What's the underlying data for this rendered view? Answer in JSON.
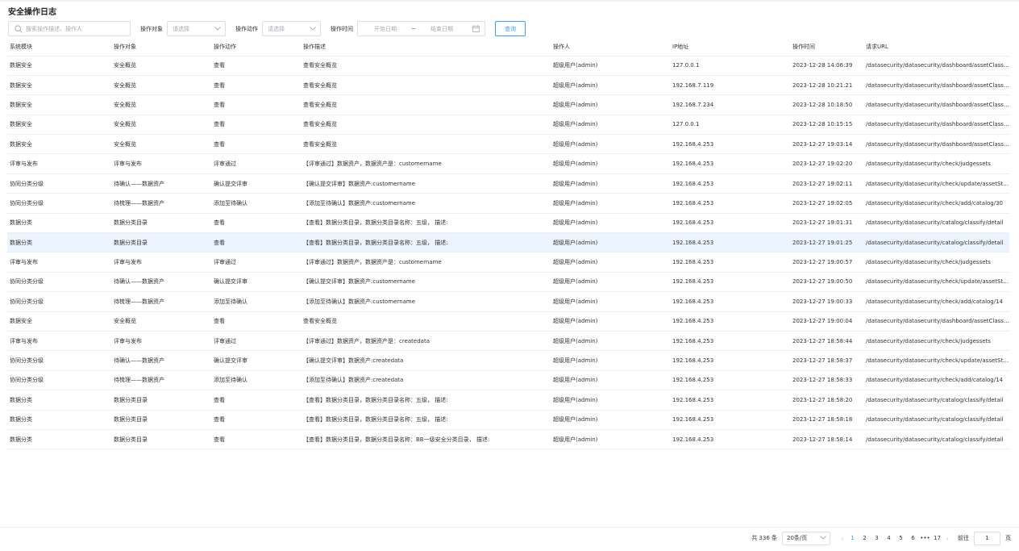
{
  "page": {
    "title": "安全操作日志"
  },
  "filters": {
    "search_placeholder": "搜索操作描述、操作人",
    "object_label": "操作对象",
    "object_placeholder": "请选择",
    "action_label": "操作动作",
    "action_placeholder": "请选择",
    "time_label": "操作时间",
    "start_placeholder": "开始日期",
    "range_sep": "~",
    "end_placeholder": "结束日期",
    "query_label": "查询"
  },
  "columns": [
    "系统模块",
    "操作对象",
    "操作动作",
    "操作描述",
    "操作人",
    "IP地址",
    "操作时间",
    "请求URL"
  ],
  "rows": [
    [
      "数据安全",
      "安全概览",
      "查看",
      "查看安全概览",
      "超级用户(admin)",
      "127.0.0.1",
      "2023-12-28 14:06:39",
      "/datasecurity/datasecurity/dashboard/assetClassify"
    ],
    [
      "数据安全",
      "安全概览",
      "查看",
      "查看安全概览",
      "超级用户(admin)",
      "192.168.7.119",
      "2023-12-28 10:21:21",
      "/datasecurity/datasecurity/dashboard/assetClassify"
    ],
    [
      "数据安全",
      "安全概览",
      "查看",
      "查看安全概览",
      "超级用户(admin)",
      "192.168.7.234",
      "2023-12-28 10:18:50",
      "/datasecurity/datasecurity/dashboard/assetClassify"
    ],
    [
      "数据安全",
      "安全概览",
      "查看",
      "查看安全概览",
      "超级用户(admin)",
      "127.0.0.1",
      "2023-12-28 10:15:15",
      "/datasecurity/datasecurity/dashboard/assetClassify"
    ],
    [
      "数据安全",
      "安全概览",
      "查看",
      "查看安全概览",
      "超级用户(admin)",
      "192.168.4.253",
      "2023-12-27 19:03:14",
      "/datasecurity/datasecurity/dashboard/assetClassify"
    ],
    [
      "评审与发布",
      "评审与发布",
      "评审通过",
      "【评审通过】数据资产，数据资产是：customername",
      "超级用户(admin)",
      "192.168.4.253",
      "2023-12-27 19:02:20",
      "/datasecurity/datasecurity/check/judgessets"
    ],
    [
      "协同分类分级",
      "待确认——数据资产",
      "确认提交评审",
      "【确认提交评审】数据资产:customername",
      "超级用户(admin)",
      "192.168.4.253",
      "2023-12-27 19:02:11",
      "/datasecurity/datasecurity/check/update/assetStatus"
    ],
    [
      "协同分类分级",
      "待梳理——数据资产",
      "添加至待确认",
      "【添加至待确认】数据资产:customername",
      "超级用户(admin)",
      "192.168.4.253",
      "2023-12-27 19:02:05",
      "/datasecurity/datasecurity/check/add/catalog/30"
    ],
    [
      "数据分类",
      "数据分类目录",
      "查看",
      "【查看】数据分类目录，数据分类目录名称：五级，  描述:",
      "超级用户(admin)",
      "192.168.4.253",
      "2023-12-27 19:01:31",
      "/datasecurity/datasecurity/catalog/classify/detail"
    ],
    [
      "数据分类",
      "数据分类目录",
      "查看",
      "【查看】数据分类目录，数据分类目录名称：五级，  描述:",
      "超级用户(admin)",
      "192.168.4.253",
      "2023-12-27 19:01:25",
      "/datasecurity/datasecurity/catalog/classify/detail"
    ],
    [
      "评审与发布",
      "评审与发布",
      "评审通过",
      "【评审通过】数据资产，数据资产是：customername",
      "超级用户(admin)",
      "192.168.4.253",
      "2023-12-27 19:00:57",
      "/datasecurity/datasecurity/check/judgessets"
    ],
    [
      "协同分类分级",
      "待确认——数据资产",
      "确认提交评审",
      "【确认提交评审】数据资产:customername",
      "超级用户(admin)",
      "192.168.4.253",
      "2023-12-27 19:00:50",
      "/datasecurity/datasecurity/check/update/assetStatus"
    ],
    [
      "协同分类分级",
      "待梳理——数据资产",
      "添加至待确认",
      "【添加至待确认】数据资产:customername",
      "超级用户(admin)",
      "192.168.4.253",
      "2023-12-27 19:00:33",
      "/datasecurity/datasecurity/check/add/catalog/14"
    ],
    [
      "数据安全",
      "安全概览",
      "查看",
      "查看安全概览",
      "超级用户(admin)",
      "192.168.4.253",
      "2023-12-27 19:00:04",
      "/datasecurity/datasecurity/dashboard/assetClassify"
    ],
    [
      "评审与发布",
      "评审与发布",
      "评审通过",
      "【评审通过】数据资产，数据资产是：createdata",
      "超级用户(admin)",
      "192.168.4.253",
      "2023-12-27 18:58:44",
      "/datasecurity/datasecurity/check/judgessets"
    ],
    [
      "协同分类分级",
      "待确认——数据资产",
      "确认提交评审",
      "【确认提交评审】数据资产:createdata",
      "超级用户(admin)",
      "192.168.4.253",
      "2023-12-27 18:58:37",
      "/datasecurity/datasecurity/check/update/assetStatus"
    ],
    [
      "协同分类分级",
      "待梳理——数据资产",
      "添加至待确认",
      "【添加至待确认】数据资产:createdata",
      "超级用户(admin)",
      "192.168.4.253",
      "2023-12-27 18:58:33",
      "/datasecurity/datasecurity/check/add/catalog/14"
    ],
    [
      "数据分类",
      "数据分类目录",
      "查看",
      "【查看】数据分类目录，数据分类目录名称：五级，  描述:",
      "超级用户(admin)",
      "192.168.4.253",
      "2023-12-27 18:58:20",
      "/datasecurity/datasecurity/catalog/classify/detail"
    ],
    [
      "数据分类",
      "数据分类目录",
      "查看",
      "【查看】数据分类目录，数据分类目录名称：五级，  描述:",
      "超级用户(admin)",
      "192.168.4.253",
      "2023-12-27 18:58:18",
      "/datasecurity/datasecurity/catalog/classify/detail"
    ],
    [
      "数据分类",
      "数据分类目录",
      "查看",
      "【查看】数据分类目录，数据分类目录名称：BB一级安全分类目录，  描述:",
      "超级用户(admin)",
      "192.168.4.253",
      "2023-12-27 18:58:14",
      "/datasecurity/datasecurity/catalog/classify/detail"
    ]
  ],
  "pagination": {
    "total_text": "共 336 条",
    "page_size": "20条/页",
    "prev": "‹",
    "pages": [
      "1",
      "2",
      "3",
      "4",
      "5",
      "6",
      "•••",
      "17"
    ],
    "next": "›",
    "goto_label": "前往",
    "goto_value": "1",
    "goto_suffix": "页"
  },
  "colors": {
    "accent": "#409eff",
    "highlight_row": "#ecf5ff",
    "border": "#ebeef5"
  },
  "icons": {
    "search": "search-icon",
    "select": "chevron-down-icon",
    "date": "calendar-icon"
  }
}
